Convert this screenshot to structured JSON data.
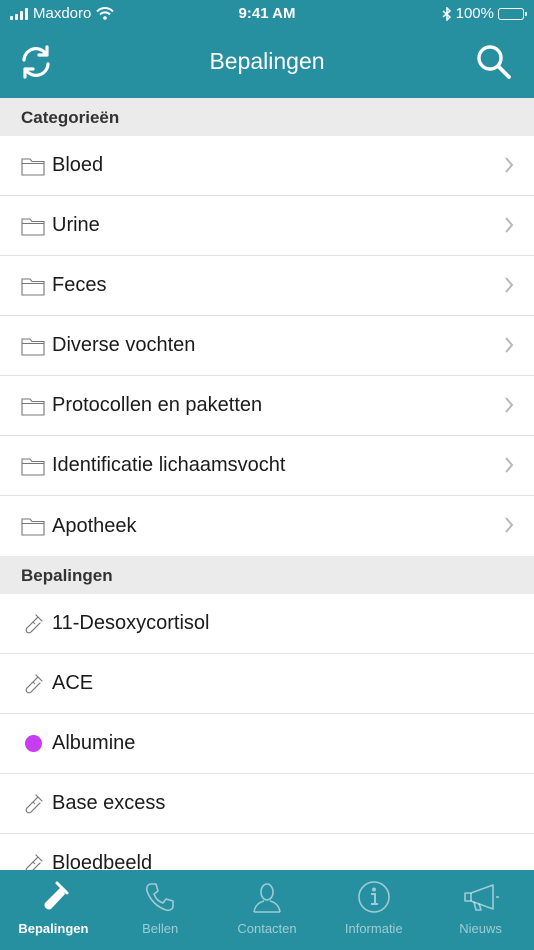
{
  "status_bar": {
    "carrier": "Maxdoro",
    "time": "9:41 AM",
    "battery": "100%"
  },
  "nav": {
    "title": "Bepalingen",
    "refresh_icon": "refresh-icon",
    "search_icon": "search-icon"
  },
  "sections": {
    "categories": {
      "header": "Categorieën",
      "items": [
        {
          "label": "Bloed"
        },
        {
          "label": "Urine"
        },
        {
          "label": "Feces"
        },
        {
          "label": "Diverse vochten"
        },
        {
          "label": "Protocollen en paketten"
        },
        {
          "label": "Identificatie lichaamsvocht"
        },
        {
          "label": "Apotheek"
        }
      ]
    },
    "determinations": {
      "header": "Bepalingen",
      "items": [
        {
          "label": "11-Desoxycortisol",
          "icon": "test-tube-icon"
        },
        {
          "label": "ACE",
          "icon": "test-tube-icon"
        },
        {
          "label": "Albumine",
          "icon": "purple-dot-icon",
          "color": "#c83cf2"
        },
        {
          "label": "Base excess",
          "icon": "test-tube-icon"
        },
        {
          "label": "Bloedbeeld",
          "icon": "test-tube-icon"
        }
      ]
    }
  },
  "tabbar": {
    "tabs": [
      {
        "label": "Bepalingen",
        "icon": "test-tube-icon",
        "active": true
      },
      {
        "label": "Bellen",
        "icon": "phone-icon",
        "active": false
      },
      {
        "label": "Contacten",
        "icon": "person-icon",
        "active": false
      },
      {
        "label": "Informatie",
        "icon": "info-icon",
        "active": false
      },
      {
        "label": "Nieuws",
        "icon": "megaphone-icon",
        "active": false
      }
    ]
  },
  "colors": {
    "brand": "#268fa0",
    "section_bg": "#ebebeb",
    "accent_dot": "#c83cf2"
  }
}
